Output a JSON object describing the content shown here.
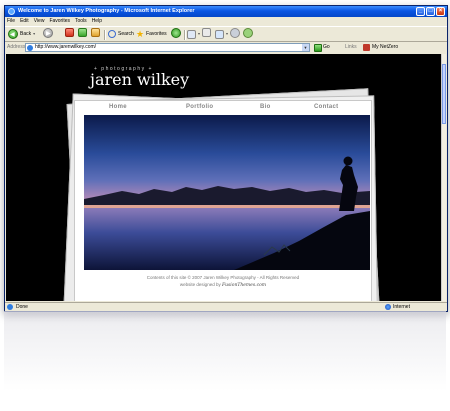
{
  "window": {
    "title": "Welcome to Jaren Wilkey Photography - Microsoft Internet Explorer"
  },
  "menu": [
    "File",
    "Edit",
    "View",
    "Favorites",
    "Tools",
    "Help"
  ],
  "toolbar": {
    "back_label": "Back",
    "search_label": "Search",
    "favorites_label": "Favorites"
  },
  "address": {
    "label": "Address",
    "url": "http://www.jarenwilkey.com/",
    "go_label": "Go",
    "links_label": "Links",
    "netzero_label": "My NetZero"
  },
  "site": {
    "tagline": "+ photography +",
    "name": "jaren wilkey",
    "nav": [
      "Home",
      "Portfolio",
      "Bio",
      "Contact"
    ],
    "footer_line1": "Contents of this site © 2007 Jaren Wilkey Photography - All Rights Reserved",
    "footer_line2_prefix": "website designed by",
    "footer_signature": "FusionThemes.com"
  },
  "status": {
    "text": "Done",
    "zone": "Internet"
  },
  "colors": {
    "titlebar": "#0a55e3",
    "chrome": "#ece9d8",
    "page_background": "#000000"
  }
}
